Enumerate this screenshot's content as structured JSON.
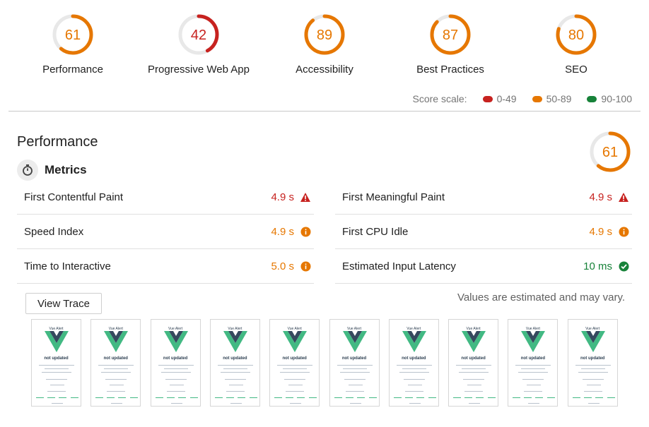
{
  "categories": [
    {
      "label": "Performance",
      "score": "61",
      "value": 0.61,
      "color": "#e67700"
    },
    {
      "label": "Progressive Web App",
      "score": "42",
      "value": 0.42,
      "color": "#c7221f"
    },
    {
      "label": "Accessibility",
      "score": "89",
      "value": 0.89,
      "color": "#e67700"
    },
    {
      "label": "Best Practices",
      "score": "87",
      "value": 0.87,
      "color": "#e67700"
    },
    {
      "label": "SEO",
      "score": "80",
      "value": 0.8,
      "color": "#e67700"
    }
  ],
  "score_scale": {
    "label": "Score scale:",
    "ranges": [
      {
        "label": "0-49",
        "color": "#c7221f"
      },
      {
        "label": "50-89",
        "color": "#e67700"
      },
      {
        "label": "90-100",
        "color": "#178239"
      }
    ]
  },
  "performance": {
    "title": "Performance",
    "score": "61",
    "value": 0.61,
    "color": "#e67700",
    "metrics_title": "Metrics",
    "metrics_left": [
      {
        "name": "First Contentful Paint",
        "value": "4.9 s",
        "status": "fail",
        "color": "#c7221f",
        "icon": "warning-icon"
      },
      {
        "name": "Speed Index",
        "value": "4.9 s",
        "status": "average",
        "color": "#e67700",
        "icon": "info-icon"
      },
      {
        "name": "Time to Interactive",
        "value": "5.0 s",
        "status": "average",
        "color": "#e67700",
        "icon": "info-icon"
      }
    ],
    "metrics_right": [
      {
        "name": "First Meaningful Paint",
        "value": "4.9 s",
        "status": "fail",
        "color": "#c7221f",
        "icon": "warning-icon"
      },
      {
        "name": "First CPU Idle",
        "value": "4.9 s",
        "status": "average",
        "color": "#e67700",
        "icon": "info-icon"
      },
      {
        "name": "Estimated Input Latency",
        "value": "10 ms",
        "status": "pass",
        "color": "#178239",
        "icon": "check-icon"
      }
    ],
    "view_trace_label": "View Trace",
    "estimate_note": "Values are estimated and may vary."
  },
  "filmstrip": {
    "frame_count": 10,
    "frame_title": "Vue Alert",
    "frame_heading": "not updated"
  }
}
